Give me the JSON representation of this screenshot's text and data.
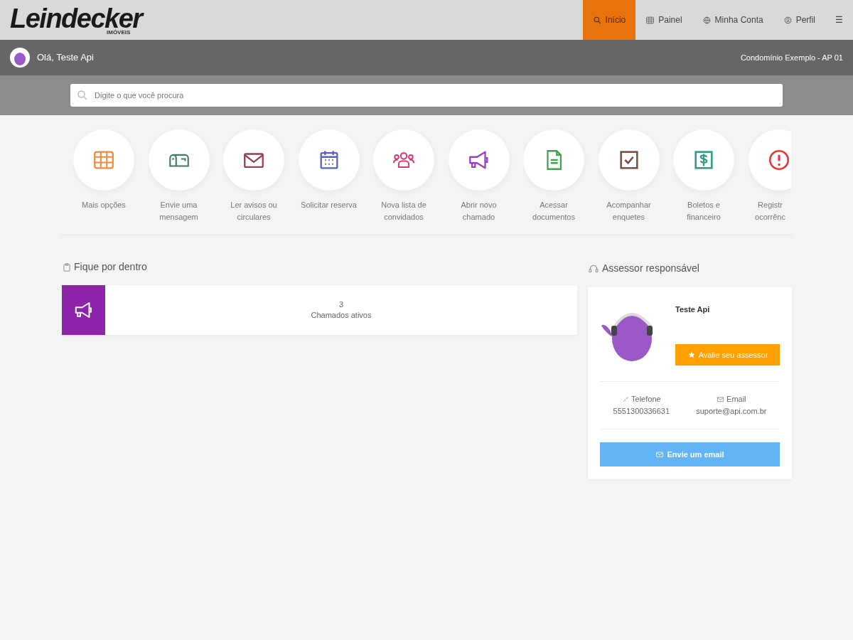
{
  "logo": {
    "name": "Leindecker",
    "sub": "IMÓVEIS"
  },
  "nav": [
    {
      "label": "Início",
      "selected": true
    },
    {
      "label": "Painel",
      "selected": false
    },
    {
      "label": "Minha Conta",
      "selected": false
    },
    {
      "label": "Perfil",
      "selected": false
    },
    {
      "label": "☰",
      "selected": false
    }
  ],
  "user_bar": {
    "greeting": "Olá, Teste Api",
    "unit": "Condomínio Exemplo - AP 01"
  },
  "search": {
    "placeholder": "Digite o que você procura"
  },
  "shortcuts": [
    {
      "label": "Mais opções"
    },
    {
      "label": "Envie uma mensagem"
    },
    {
      "label": "Ler avisos ou circulares"
    },
    {
      "label": "Solicitar reserva"
    },
    {
      "label": "Nova lista de convidados"
    },
    {
      "label": "Abrir novo chamado"
    },
    {
      "label": "Acessar documentos"
    },
    {
      "label": "Acompanhar enquetes"
    },
    {
      "label": "Boletos e financeiro"
    },
    {
      "label": "Registr ocorrênc"
    }
  ],
  "news": {
    "title": "Fique por dentro",
    "items": [
      {
        "count": "3",
        "label": "Chamados ativos"
      }
    ]
  },
  "advisor": {
    "title": "Assessor responsável",
    "name": "Teste Api",
    "rate_button": "Avalie seu assessor",
    "phone_label": "Telefone",
    "phone": "5551300336631",
    "email_label": "Email",
    "email": "suporte@api.com.br",
    "email_button": "Envie um email"
  }
}
